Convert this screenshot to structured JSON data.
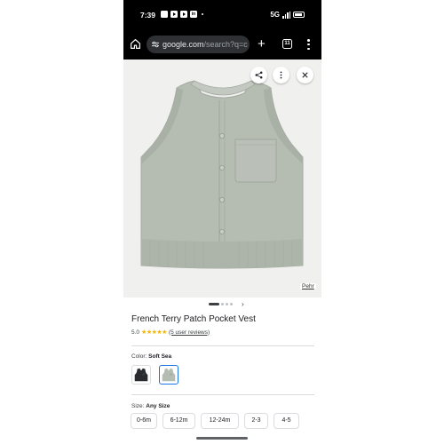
{
  "status_bar": {
    "time": "7:39",
    "network": "5G",
    "notification_icons": [
      "photos-icon",
      "youtube-icon",
      "youtube-icon",
      "linkedin-icon"
    ]
  },
  "browser": {
    "url_host": "google.com",
    "url_path": "/search?q=c",
    "tab_count": "11"
  },
  "product_image": {
    "source_label": "Pehr",
    "garment_color": "#b5bcb2",
    "image_count": 4,
    "active_image": 1
  },
  "product": {
    "title": "French Terry Patch Pocket Vest",
    "rating_value": "5.0",
    "stars": "★★★★★",
    "star_rating": 5,
    "reviews": "(5 user reviews)"
  },
  "color": {
    "label": "Color:",
    "selected": "Soft Sea",
    "swatches": [
      {
        "name": "black",
        "hex": "#2a2b2e"
      },
      {
        "name": "Soft Sea",
        "hex": "#b5bcb2"
      }
    ],
    "accent": "#1a73e8"
  },
  "size": {
    "label": "Size:",
    "selected": "Any Size",
    "options": [
      "0-6m",
      "6-12m",
      "12-24m",
      "2-3",
      "4-5"
    ]
  }
}
